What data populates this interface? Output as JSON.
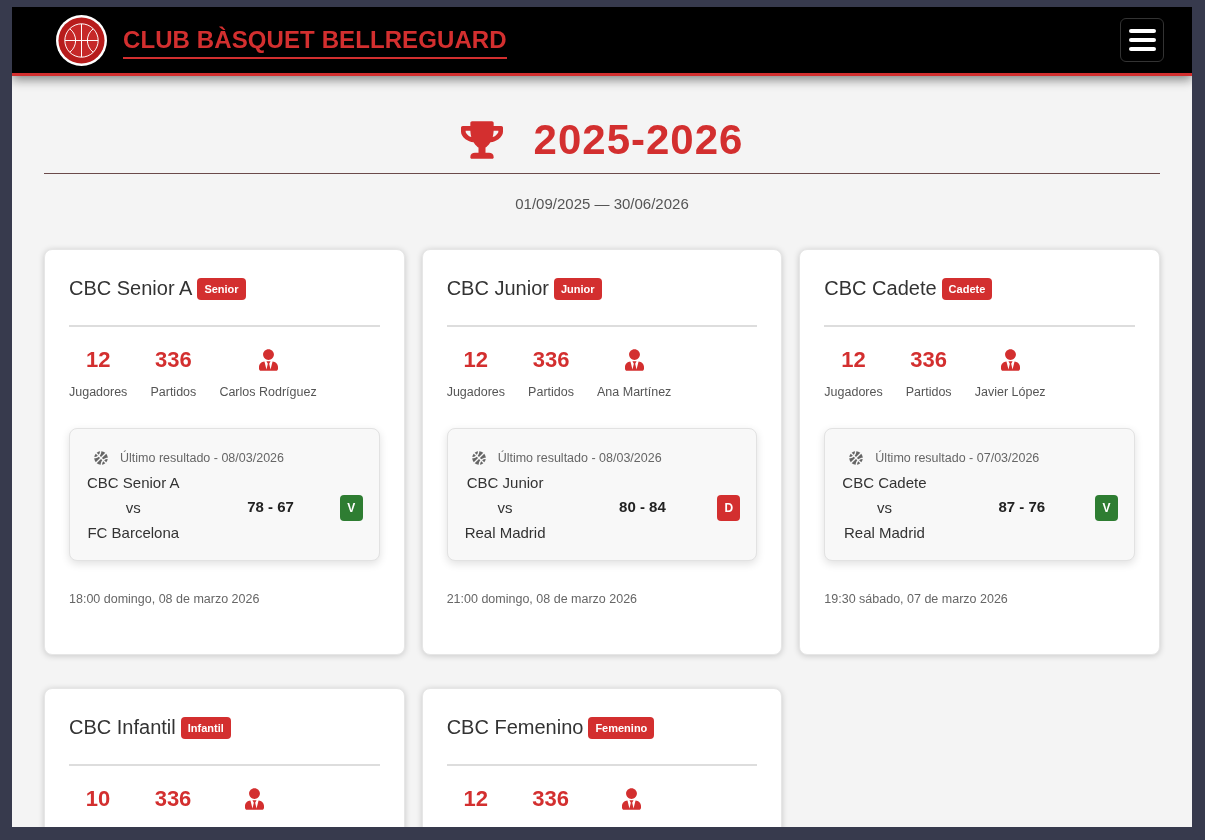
{
  "header": {
    "title": "CLUB BÀSQUET BELLREGUARD"
  },
  "season": {
    "title": "2025-2026",
    "dates": "01/09/2025 — 30/06/2026"
  },
  "teams": [
    {
      "name": "CBC Senior A",
      "category": "Senior",
      "stats": [
        {
          "value": "12",
          "label": "Jugadores"
        },
        {
          "value": "336",
          "label": "Partidos"
        }
      ],
      "coach": "Carlos Rodríguez",
      "last_result": {
        "heading": "Último resultado - 08/03/2026",
        "home": "CBC Senior A",
        "vs": "vs",
        "away": "FC Barcelona",
        "score": "78 - 67",
        "outcome": "V",
        "kind": "win"
      },
      "datetime": "18:00 domingo, 08 de marzo 2026"
    },
    {
      "name": "CBC Junior",
      "category": "Junior",
      "stats": [
        {
          "value": "12",
          "label": "Jugadores"
        },
        {
          "value": "336",
          "label": "Partidos"
        }
      ],
      "coach": "Ana Martínez",
      "last_result": {
        "heading": "Último resultado - 08/03/2026",
        "home": "CBC Junior",
        "vs": "vs",
        "away": "Real Madrid",
        "score": "80 - 84",
        "outcome": "D",
        "kind": "loss"
      },
      "datetime": "21:00 domingo, 08 de marzo 2026"
    },
    {
      "name": "CBC Cadete",
      "category": "Cadete",
      "stats": [
        {
          "value": "12",
          "label": "Jugadores"
        },
        {
          "value": "336",
          "label": "Partidos"
        }
      ],
      "coach": "Javier López",
      "last_result": {
        "heading": "Último resultado - 07/03/2026",
        "home": "CBC Cadete",
        "vs": "vs",
        "away": "Real Madrid",
        "score": "87 - 76",
        "outcome": "V",
        "kind": "win"
      },
      "datetime": "19:30 sábado, 07 de marzo 2026"
    },
    {
      "name": "CBC Infantil",
      "category": "Infantil",
      "stats": [
        {
          "value": "10"
        },
        {
          "value": "336"
        }
      ]
    },
    {
      "name": "CBC Femenino",
      "category": "Femenino",
      "stats": [
        {
          "value": "12"
        },
        {
          "value": "336"
        }
      ]
    }
  ]
}
